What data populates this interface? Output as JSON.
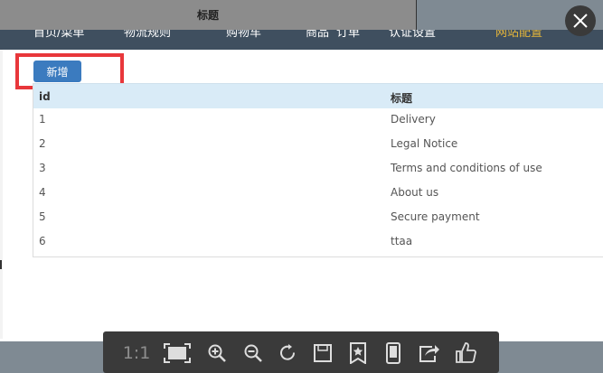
{
  "window": {
    "title_tab": "标题"
  },
  "nav": {
    "items": [
      "首页/菜单",
      "物流规则",
      "购物车",
      "商品",
      "订单",
      "认证设置",
      "网站配置"
    ],
    "accent_index": 6,
    "colors": {
      "background": "#3f4f5f",
      "accent": "#e3b53b"
    }
  },
  "toolbar_top": {
    "add_button_label": "新增"
  },
  "table": {
    "headers": [
      "id",
      "标题"
    ],
    "rows": [
      [
        "1",
        "Delivery"
      ],
      [
        "2",
        "Legal Notice"
      ],
      [
        "3",
        "Terms and conditions of use"
      ],
      [
        "4",
        "About us"
      ],
      [
        "5",
        "Secure payment"
      ],
      [
        "6",
        "ttaa"
      ]
    ]
  },
  "viewer_toolbar": {
    "actual_size_label": "1:1",
    "icons": [
      "actual-size-icon",
      "fit-screen-icon",
      "zoom-in-icon",
      "zoom-out-icon",
      "rotate-icon",
      "save-icon",
      "favorite-icon",
      "mobile-icon",
      "share-icon",
      "like-icon"
    ]
  },
  "colors": {
    "highlight": "#e8373b",
    "primary_button": "#3b7bbf",
    "table_header_bg": "#d9ebf7"
  }
}
